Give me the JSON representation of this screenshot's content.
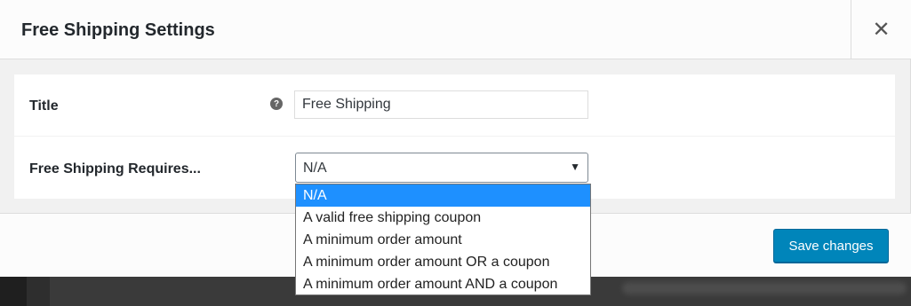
{
  "modal": {
    "title": "Free Shipping Settings",
    "close_glyph": "✕"
  },
  "fields": {
    "title_label": "Title",
    "title_value": "Free Shipping",
    "help_glyph": "?",
    "requires_label": "Free Shipping Requires...",
    "requires_selected": "N/A",
    "select_arrow": "▼"
  },
  "dropdown": {
    "options": [
      "N/A",
      "A valid free shipping coupon",
      "A minimum order amount",
      "A minimum order amount OR a coupon",
      "A minimum order amount AND a coupon"
    ],
    "selected_index": 0
  },
  "footer": {
    "save_label": "Save changes"
  },
  "colors": {
    "accent": "#0085ba",
    "option_highlight": "#1e90ff"
  }
}
